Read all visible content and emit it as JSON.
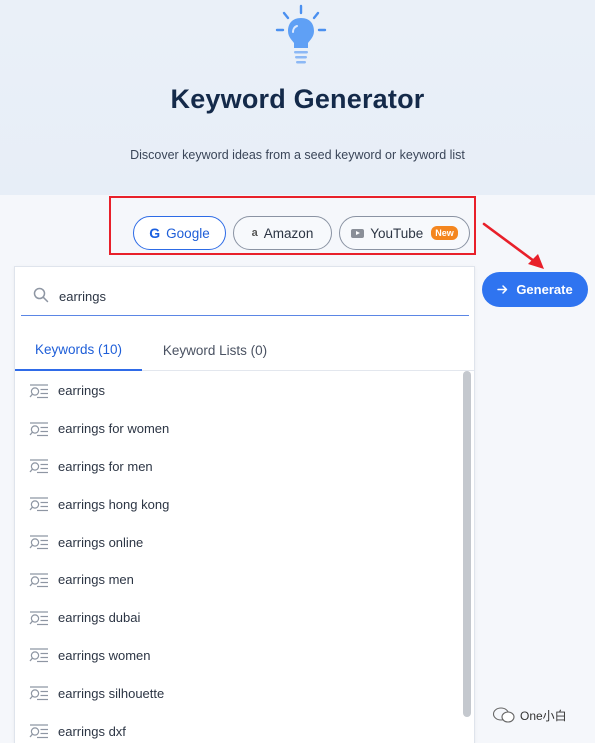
{
  "header": {
    "title": "Keyword Generator",
    "subtitle": "Discover keyword ideas from a seed keyword or keyword list"
  },
  "sources": [
    {
      "label": "Google",
      "icon": "google-g-icon",
      "active": true
    },
    {
      "label": "Amazon",
      "icon": "amazon-a-icon",
      "active": false
    },
    {
      "label": "YouTube",
      "icon": "youtube-icon",
      "active": false,
      "badge": "New"
    }
  ],
  "generate_button": {
    "label": "Generate",
    "icon": "arrow-right-icon"
  },
  "search": {
    "value": "earrings",
    "placeholder": ""
  },
  "tabs": [
    {
      "label": "Keywords (10)",
      "active": true
    },
    {
      "label": "Keyword Lists (0)",
      "active": false
    }
  ],
  "keywords": [
    "earrings",
    "earrings for women",
    "earrings for men",
    "earrings hong kong",
    "earrings online",
    "earrings men",
    "earrings dubai",
    "earrings women",
    "earrings silhouette",
    "earrings dxf"
  ],
  "watermark": {
    "text": "One小白"
  },
  "colors": {
    "accent": "#2f74f0",
    "highlight": "#e8202a",
    "badge": "#f4861f"
  }
}
